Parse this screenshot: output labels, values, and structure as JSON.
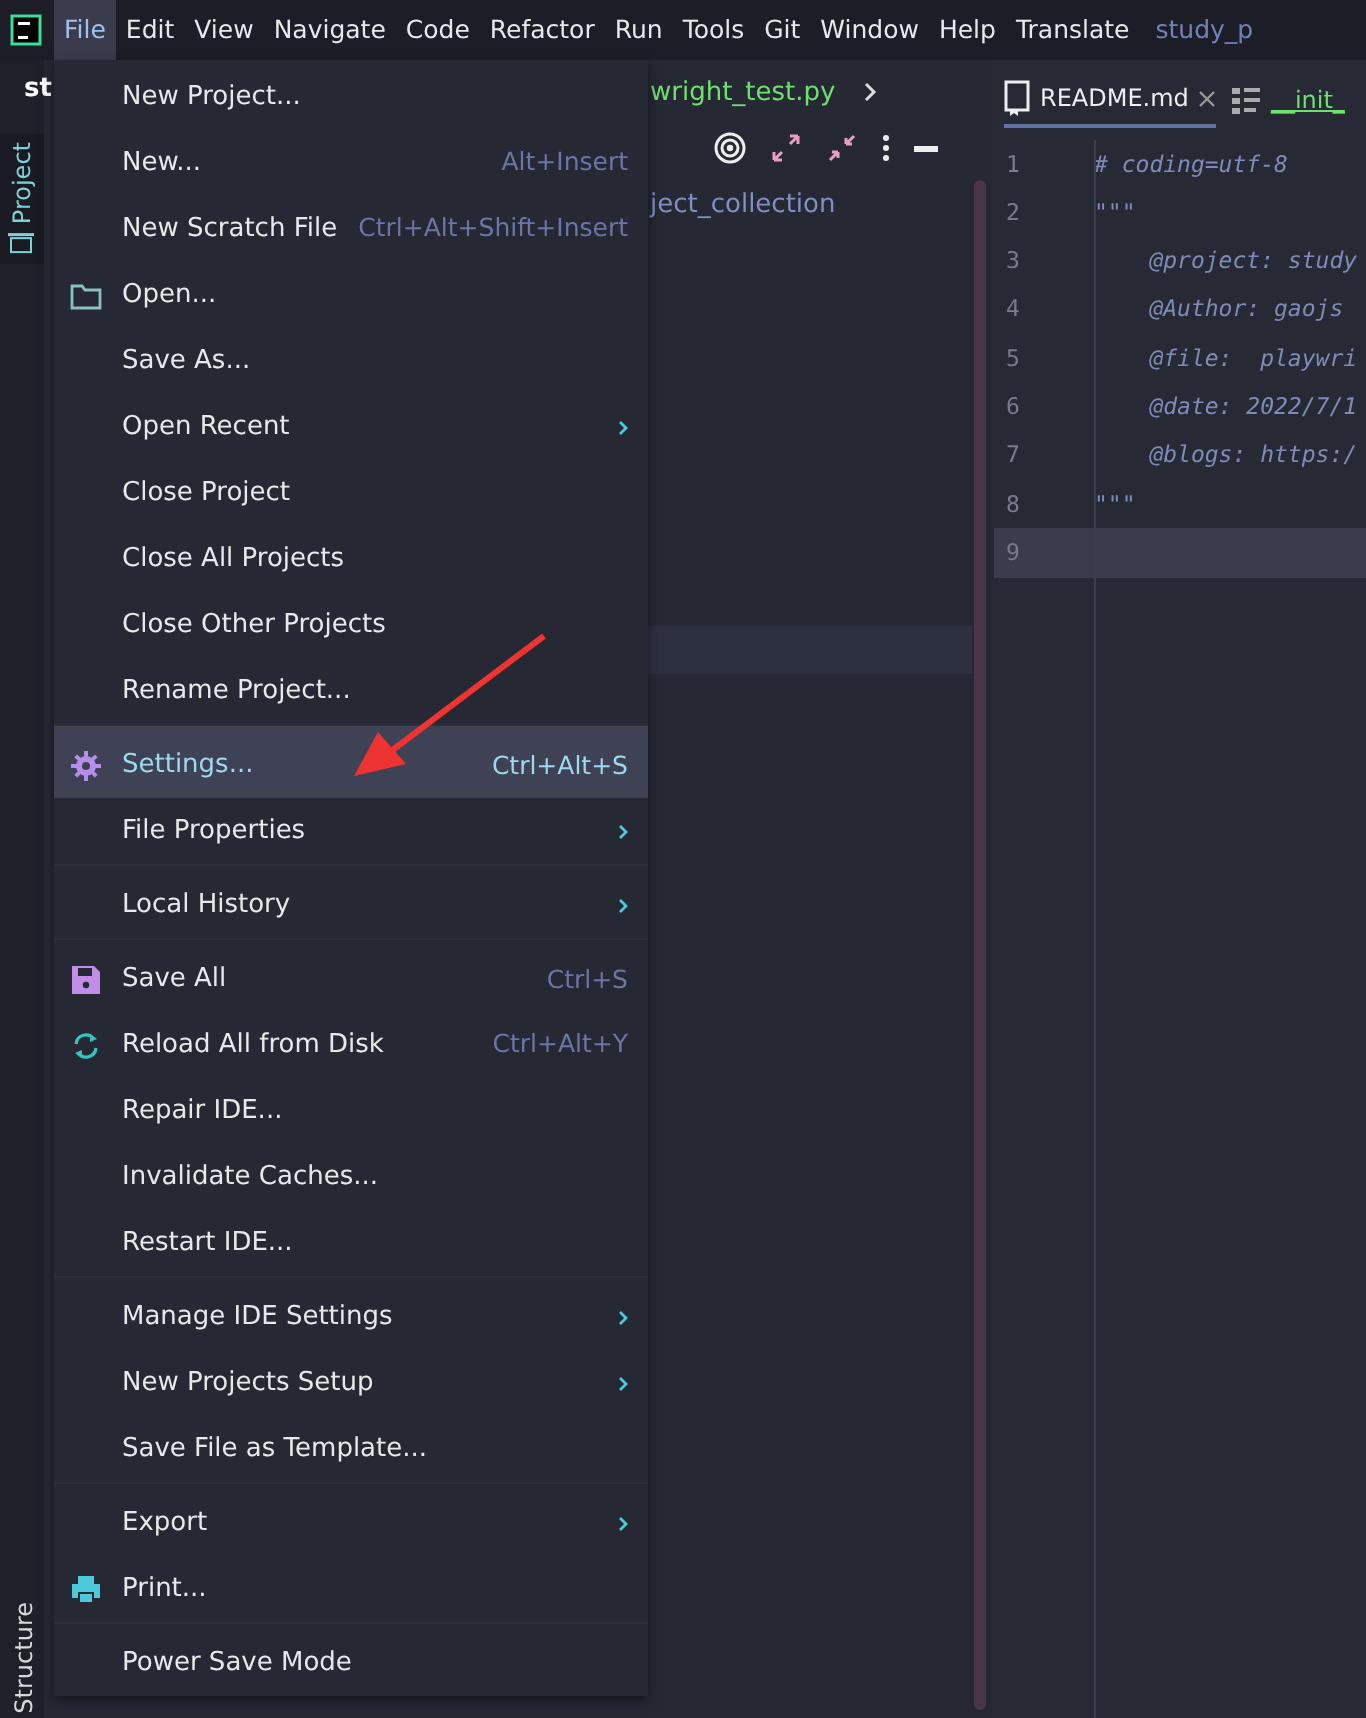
{
  "menubar": {
    "items": [
      {
        "label": "File",
        "selected": true
      },
      {
        "label": "Edit",
        "selected": false
      },
      {
        "label": "View",
        "selected": false
      },
      {
        "label": "Navigate",
        "selected": false
      },
      {
        "label": "Code",
        "selected": false
      },
      {
        "label": "Refactor",
        "selected": false
      },
      {
        "label": "Run",
        "selected": false
      },
      {
        "label": "Tools",
        "selected": false
      },
      {
        "label": "Git",
        "selected": false
      },
      {
        "label": "Window",
        "selected": false
      },
      {
        "label": "Help",
        "selected": false
      },
      {
        "label": "Translate",
        "selected": false
      }
    ],
    "project_title": "study_p"
  },
  "left_strip": {
    "top_tab": "Project",
    "bottom_tab": "Structure"
  },
  "project_panel": {
    "title": "st",
    "breadcrumb": "wright_test.py",
    "tree_item": "ject_collection"
  },
  "editor": {
    "tabs": [
      {
        "label": "README.md",
        "selected": true,
        "kind": "readme"
      },
      {
        "label": "__init_",
        "selected": false,
        "kind": "python"
      }
    ],
    "lines": [
      {
        "number": "1",
        "text": "# coding=utf-8",
        "current": false
      },
      {
        "number": "2",
        "text": "\"\"\"",
        "current": false
      },
      {
        "number": "3",
        "text": "    @project: study",
        "current": false
      },
      {
        "number": "4",
        "text": "    @Author: gaojs",
        "current": false
      },
      {
        "number": "5",
        "text": "    @file:  playwri",
        "current": false
      },
      {
        "number": "6",
        "text": "    @date: 2022/7/1",
        "current": false
      },
      {
        "number": "7",
        "text": "    @blogs: https:/",
        "current": false
      },
      {
        "number": "8",
        "text": "\"\"\"",
        "current": false
      },
      {
        "number": "9",
        "current": true
      }
    ]
  },
  "file_menu": {
    "items": [
      {
        "label": "New Project...",
        "submenu": false,
        "separator_before": false,
        "selected": false
      },
      {
        "label": "New...",
        "shortcut": "Alt+Insert",
        "submenu": false,
        "separator_before": false,
        "selected": false
      },
      {
        "label": "New Scratch File",
        "shortcut": "Ctrl+Alt+Shift+Insert",
        "submenu": false,
        "separator_before": false,
        "selected": false
      },
      {
        "label": "Open...",
        "submenu": false,
        "separator_before": false,
        "selected": false
      },
      {
        "label": "Save As...",
        "submenu": false,
        "separator_before": false,
        "selected": false
      },
      {
        "label": "Open Recent",
        "submenu": true,
        "separator_before": false,
        "selected": false
      },
      {
        "label": "Close Project",
        "submenu": false,
        "separator_before": false,
        "selected": false
      },
      {
        "label": "Close All Projects",
        "submenu": false,
        "separator_before": false,
        "selected": false
      },
      {
        "label": "Close Other Projects",
        "submenu": false,
        "separator_before": false,
        "selected": false
      },
      {
        "label": "Rename Project...",
        "submenu": false,
        "separator_before": false,
        "selected": false
      },
      {
        "label": "Settings...",
        "shortcut": "Ctrl+Alt+S",
        "submenu": false,
        "separator_before": true,
        "selected": true
      },
      {
        "label": "File Properties",
        "submenu": true,
        "separator_before": false,
        "selected": false
      },
      {
        "label": "Local History",
        "submenu": true,
        "separator_before": true,
        "selected": false
      },
      {
        "label": "Save All",
        "shortcut": "Ctrl+S",
        "submenu": false,
        "separator_before": true,
        "selected": false
      },
      {
        "label": "Reload All from Disk",
        "shortcut": "Ctrl+Alt+Y",
        "submenu": false,
        "separator_before": false,
        "selected": false
      },
      {
        "label": "Repair IDE...",
        "submenu": false,
        "separator_before": false,
        "selected": false
      },
      {
        "label": "Invalidate Caches...",
        "submenu": false,
        "separator_before": false,
        "selected": false
      },
      {
        "label": "Restart IDE...",
        "submenu": false,
        "separator_before": false,
        "selected": false
      },
      {
        "label": "Manage IDE Settings",
        "submenu": true,
        "separator_before": true,
        "selected": false
      },
      {
        "label": "New Projects Setup",
        "submenu": true,
        "separator_before": false,
        "selected": false
      },
      {
        "label": "Save File as Template...",
        "submenu": false,
        "separator_before": false,
        "selected": false
      },
      {
        "label": "Export",
        "submenu": true,
        "separator_before": true,
        "selected": false
      },
      {
        "label": "Print...",
        "submenu": false,
        "separator_before": false,
        "selected": false
      },
      {
        "label": "Power Save Mode",
        "submenu": false,
        "separator_before": true,
        "selected": false
      }
    ]
  }
}
